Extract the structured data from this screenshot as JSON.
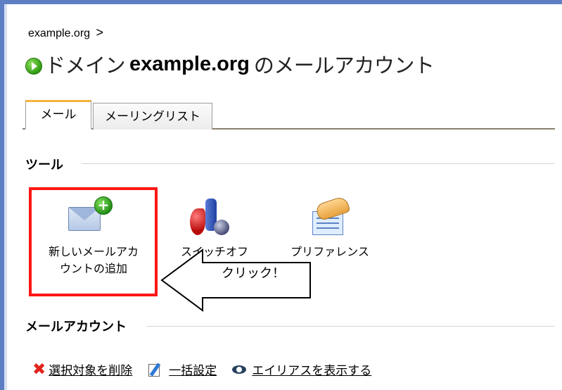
{
  "breadcrumb": {
    "domain": "example.org",
    "separator": ">"
  },
  "page_title": {
    "prefix": "ドメイン",
    "domain": "example.org",
    "suffix": "のメールアカウント"
  },
  "tabs": [
    {
      "label": "メール",
      "active": true
    },
    {
      "label": "メーリングリスト",
      "active": false
    }
  ],
  "tools_section": {
    "heading": "ツール",
    "items": [
      {
        "line1": "新しいメールアカ",
        "line2": "ウントの追加",
        "icon": "envelope-add-icon"
      },
      {
        "label": "スイッチオフ",
        "icon": "switch-icon"
      },
      {
        "label": "プリファレンス",
        "icon": "preferences-icon"
      }
    ]
  },
  "callout": {
    "text": "クリック！"
  },
  "accounts_section": {
    "heading": "メールアカウント",
    "actions": [
      {
        "label": "選択対象を削除",
        "icon": "delete-x-icon"
      },
      {
        "label": "一括設定",
        "icon": "edit-icon"
      },
      {
        "label": "エイリアスを表示する",
        "icon": "eye-icon"
      }
    ]
  },
  "colors": {
    "frame": "#5f7fc4",
    "highlight": "#ff1616",
    "active_tab_accent": "#f3b33d"
  }
}
